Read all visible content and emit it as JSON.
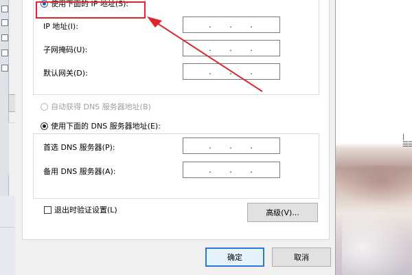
{
  "dialog": {
    "ip_section": {
      "use_following_label": "使用下面的 IP 地址(S):",
      "fields": [
        {
          "label": "IP 地址(I):",
          "value": ".  .  ."
        },
        {
          "label": "子网掩码(U):",
          "value": ".  .  ."
        },
        {
          "label": "默认网关(D):",
          "value": ".  .  ."
        }
      ]
    },
    "dns_section": {
      "auto_label": "自动获得 DNS 服务器地址(B)",
      "use_following_label": "使用下面的 DNS 服务器地址(E):",
      "fields": [
        {
          "label": "首选 DNS 服务器(P):",
          "value": ".  .  ."
        },
        {
          "label": "备用 DNS 服务器(A):",
          "value": ".  .  ."
        }
      ]
    },
    "validate_label": "退出时验证设置(L)",
    "advanced_button": "高级(V)...",
    "ok_button": "确定",
    "cancel_button": "取消"
  },
  "annotation": {
    "highlight_color": "#e0242d"
  },
  "background": {
    "doc_glyph": "|☰☰"
  }
}
